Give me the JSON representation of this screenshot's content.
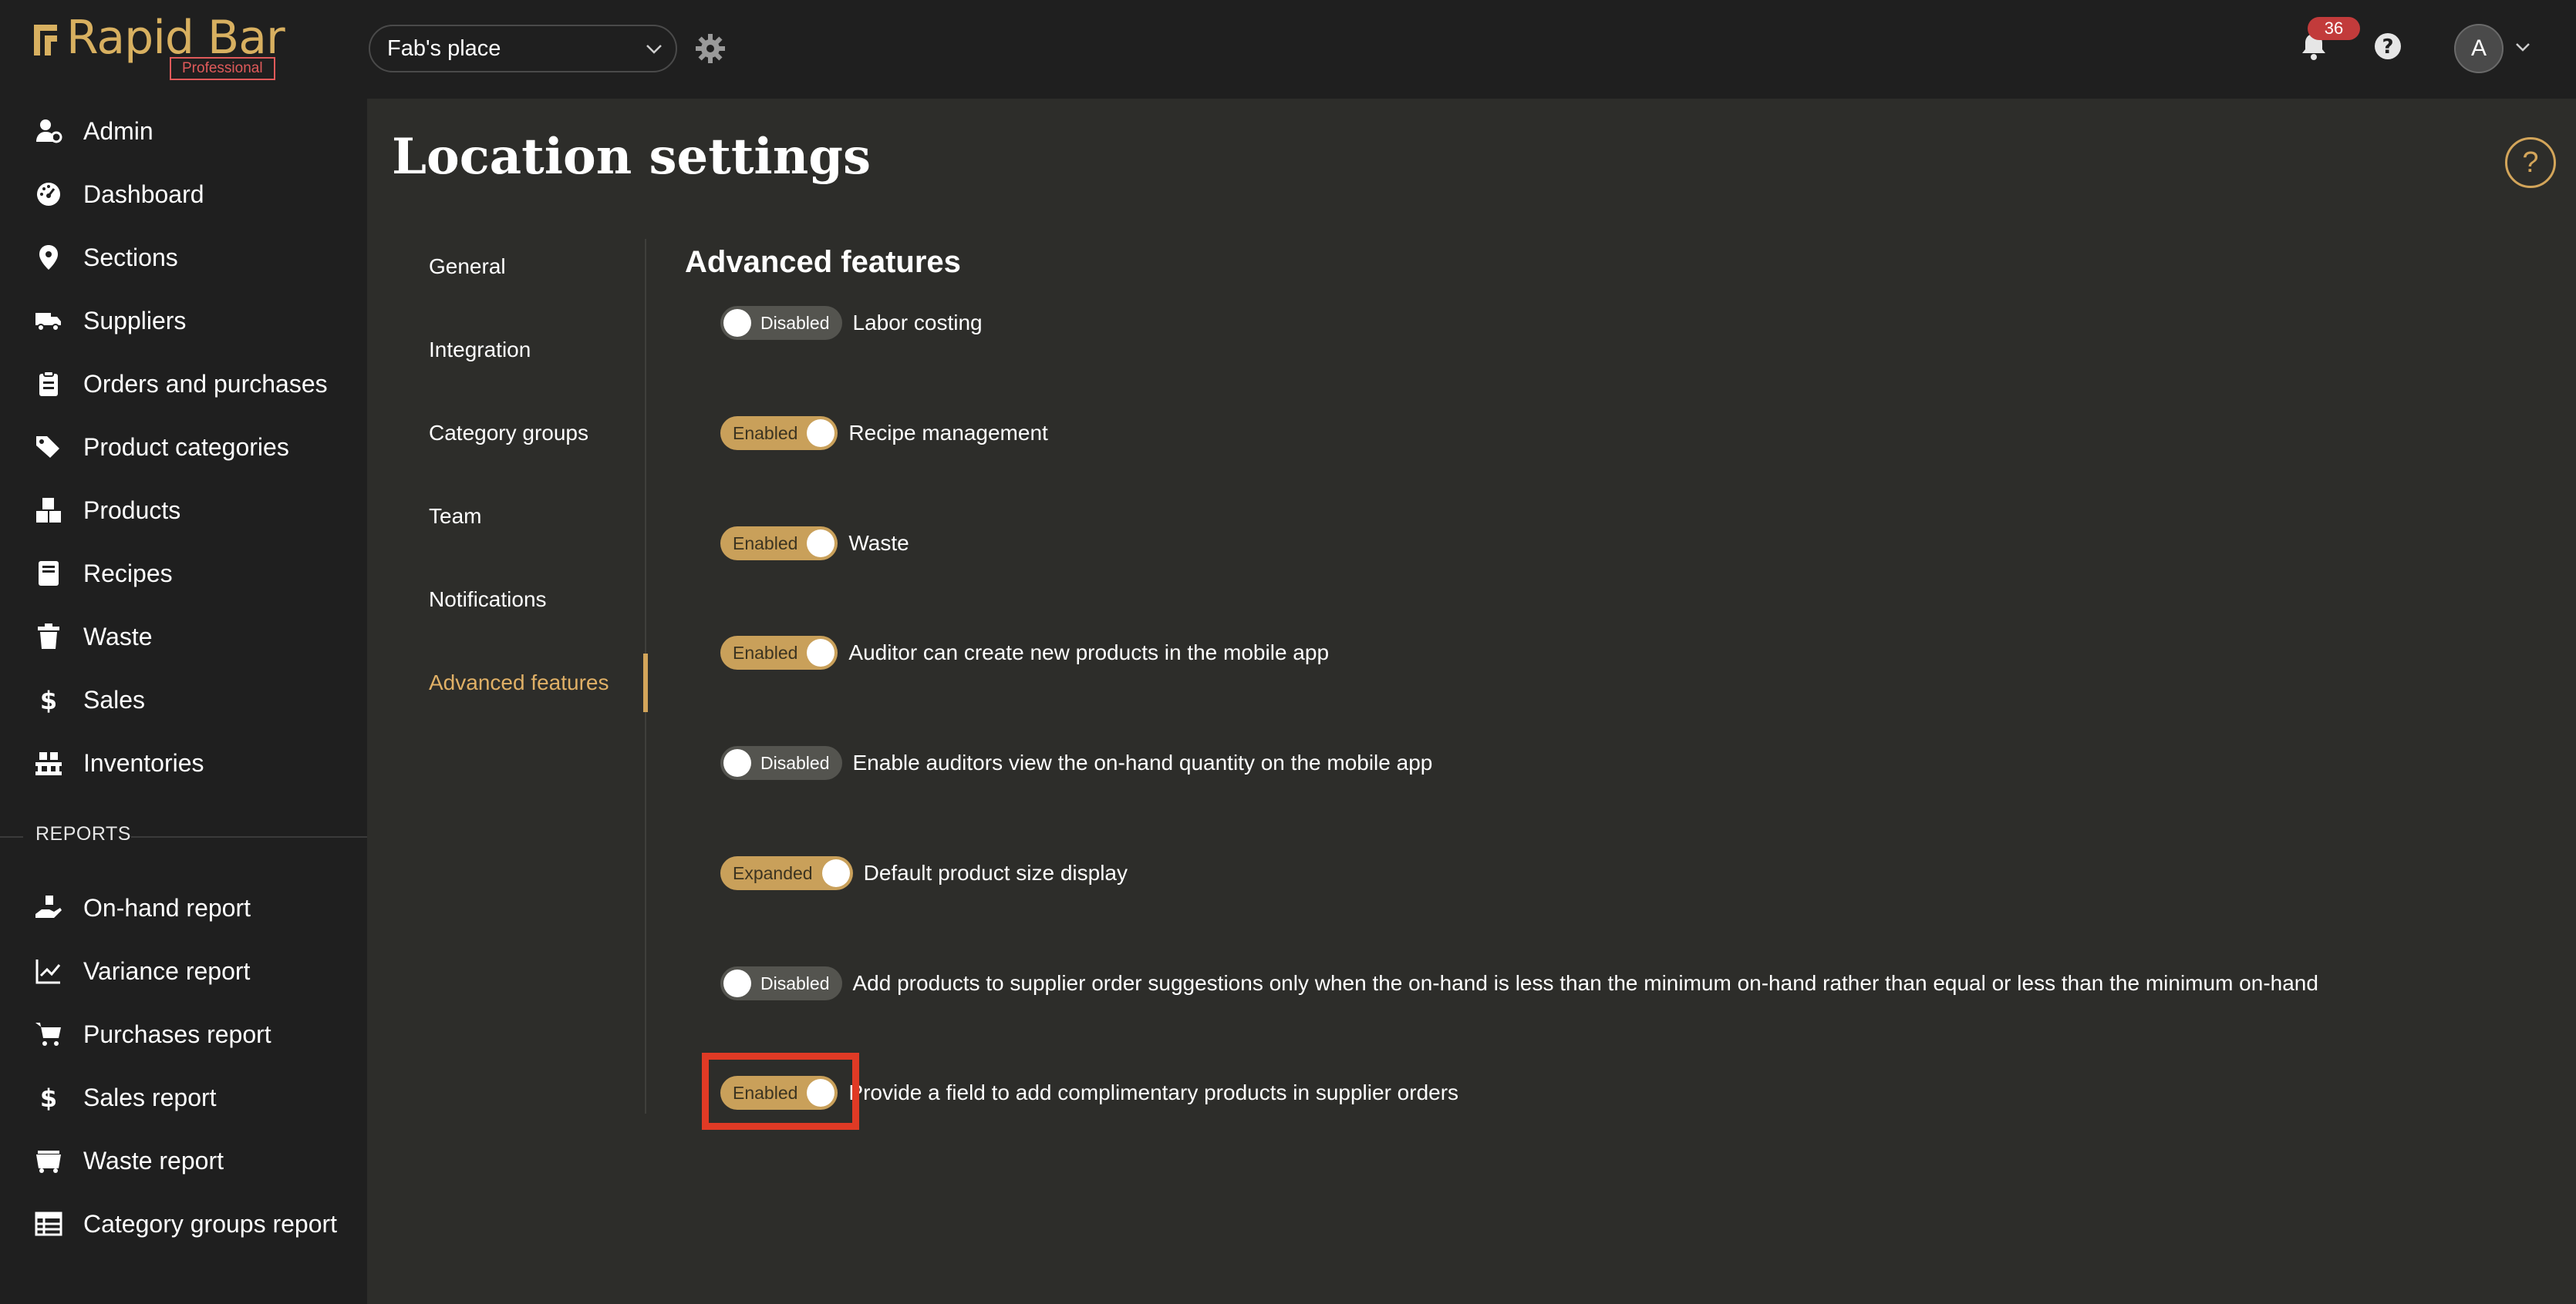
{
  "app": {
    "logo_text": "Rapid Bar",
    "logo_badge": "Professional",
    "brand_color": "#d8b060"
  },
  "sidebar": {
    "items": [
      {
        "label": "Admin",
        "icon": "admin-user-icon"
      },
      {
        "label": "Dashboard",
        "icon": "dashboard-gauge-icon"
      },
      {
        "label": "Sections",
        "icon": "map-pin-icon"
      },
      {
        "label": "Suppliers",
        "icon": "truck-icon"
      },
      {
        "label": "Orders and purchases",
        "icon": "clipboard-icon"
      },
      {
        "label": "Product categories",
        "icon": "tags-icon"
      },
      {
        "label": "Products",
        "icon": "boxes-icon"
      },
      {
        "label": "Recipes",
        "icon": "book-icon"
      },
      {
        "label": "Waste",
        "icon": "trash-icon"
      },
      {
        "label": "Sales",
        "icon": "dollar-icon"
      },
      {
        "label": "Inventories",
        "icon": "pallet-icon"
      }
    ],
    "reports_heading": "REPORTS",
    "reports": [
      {
        "label": "On-hand report",
        "icon": "hand-holding-icon"
      },
      {
        "label": "Variance report",
        "icon": "line-chart-icon"
      },
      {
        "label": "Purchases report",
        "icon": "cart-icon"
      },
      {
        "label": "Sales report",
        "icon": "dollar-icon"
      },
      {
        "label": "Waste report",
        "icon": "dumpster-icon"
      },
      {
        "label": "Category groups report",
        "icon": "table-icon"
      }
    ]
  },
  "topbar": {
    "location": "Fab's place",
    "notification_count": "36",
    "avatar_initial": "A"
  },
  "page": {
    "title": "Location settings",
    "help_glyph": "?"
  },
  "subnav": {
    "items": [
      "General",
      "Integration",
      "Category groups",
      "Team",
      "Notifications",
      "Advanced features"
    ],
    "active": "Advanced features"
  },
  "advanced": {
    "title": "Advanced features",
    "features": [
      {
        "state": "Disabled",
        "on": false,
        "label": "Labor costing"
      },
      {
        "state": "Enabled",
        "on": true,
        "label": "Recipe management"
      },
      {
        "state": "Enabled",
        "on": true,
        "label": "Waste"
      },
      {
        "state": "Enabled",
        "on": true,
        "label": "Auditor can create new products in the mobile app"
      },
      {
        "state": "Disabled",
        "on": false,
        "label": "Enable auditors view the on-hand quantity on the mobile app"
      },
      {
        "state": "Expanded",
        "on": true,
        "label": "Default product size display"
      },
      {
        "state": "Disabled",
        "on": false,
        "label": "Add products to supplier order suggestions only when the on-hand is less than the minimum on-hand rather than equal or less than the minimum on-hand"
      },
      {
        "state": "Enabled",
        "on": true,
        "label": "Provide a field to add complimentary products in supplier orders"
      }
    ]
  },
  "colors": {
    "accent": "#d3a55a",
    "toggle_on": "#c9a05a",
    "toggle_off": "#54544f",
    "highlight": "#e03a25",
    "badge": "#c23b3b"
  }
}
